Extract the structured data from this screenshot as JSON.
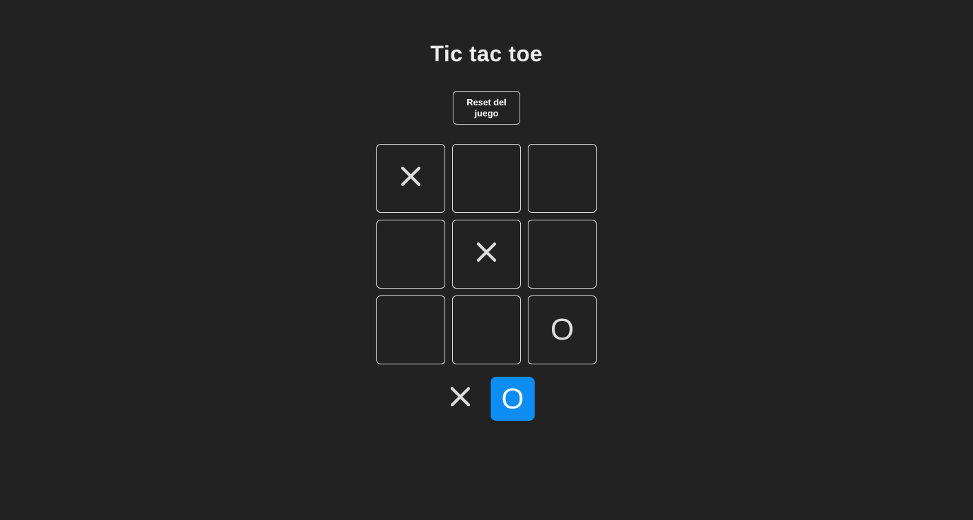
{
  "title": "Tic tac toe",
  "reset_label": "Reset del juego",
  "board": {
    "cells": [
      "X",
      "",
      "",
      "",
      "X",
      "",
      "",
      "",
      "O"
    ]
  },
  "turn": {
    "x_label": "✕",
    "o_label": "O",
    "active": "O"
  },
  "colors": {
    "bg": "#222222",
    "accent": "#0d8df2",
    "border": "#dddddd"
  }
}
